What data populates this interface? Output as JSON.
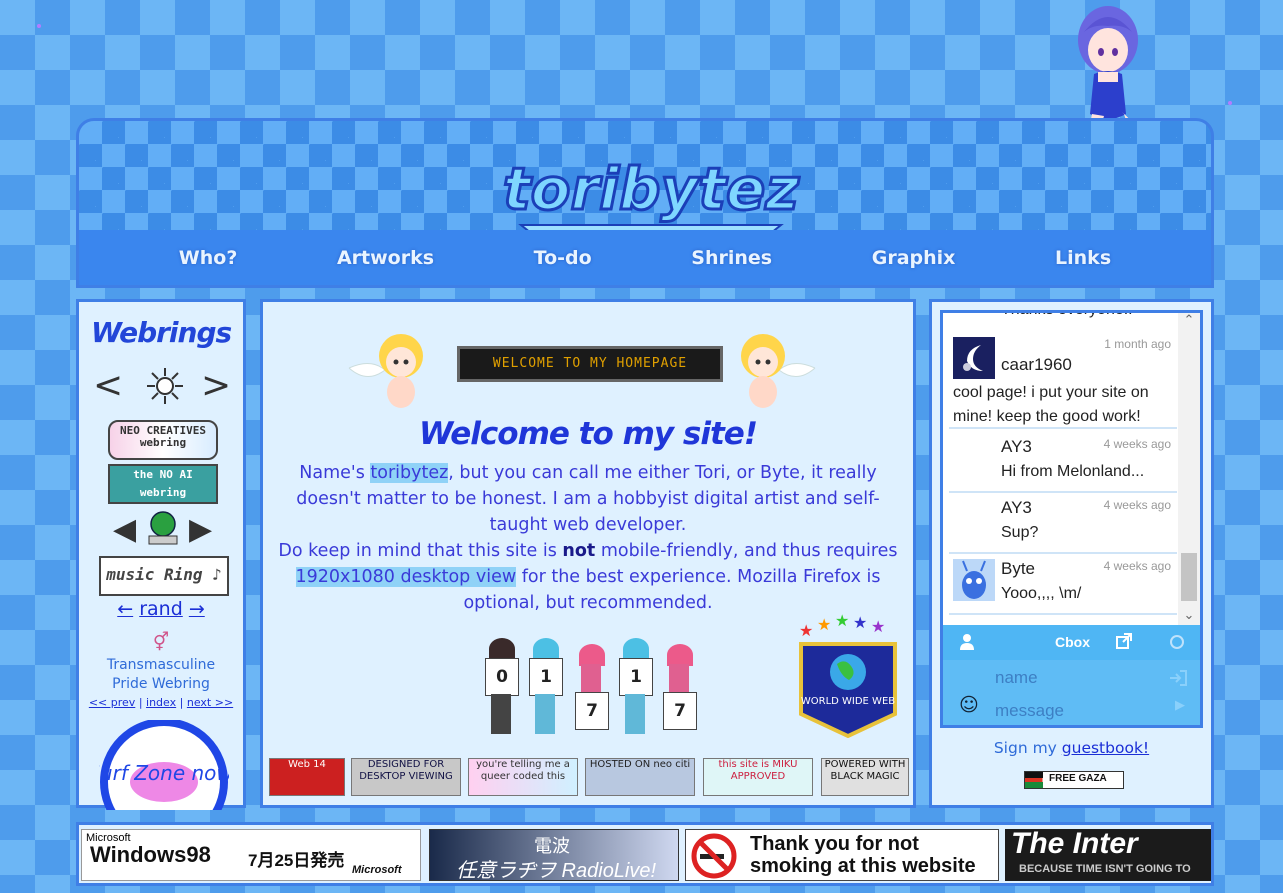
{
  "header": {
    "logo_text": "toribytez",
    "nav": [
      "Who?",
      "Artworks",
      "To-do",
      "Shrines",
      "Graphix",
      "Links"
    ]
  },
  "left": {
    "title": "Webrings",
    "prev_symbol": "<",
    "next_symbol": ">",
    "neo_badge": "NEO CREATIVES webring",
    "noai_badge_a": "the NO AI",
    "noai_badge_b": "webring",
    "music_badge": "music Ring",
    "rand_prev": "←",
    "rand_label": "rand",
    "rand_next": "→",
    "trans_title": "Transmasculine Pride Webring",
    "trans_prev": "<< prev",
    "trans_index": "index",
    "trans_next": "next >>",
    "sep": "|",
    "surf_text": "Surf Zone now!"
  },
  "main": {
    "marquee": "WELCOME TO MY HOMEPAGE",
    "title": "Welcome to my site!",
    "p1_a": "Name's ",
    "p1_name": "toribytez",
    "p1_b": ", but you can call me either Tori, or Byte, it really doesn't matter to be honest. I am a hobbyist digital artist and self-taught web developer.",
    "p2_a": "Do keep in mind that this site is ",
    "p2_not": "not",
    "p2_b": " mobile-friendly, and thus requires ",
    "p2_hl": "1920x1080 desktop view",
    "p2_c": " for the best experience. Mozilla Firefox is optional, but recommended.",
    "counter_digits": [
      "0",
      "1",
      "7",
      "1",
      "7"
    ],
    "www_badge": "WORLD WIDE WEB",
    "badges": [
      {
        "label": "Web 14",
        "color": "#cc2020"
      },
      {
        "label": "DESIGNED FOR DESKTOP VIEWING",
        "color": "#c8c8c8"
      },
      {
        "label": "you're telling me a queer coded this",
        "color": "#f0a0e0"
      },
      {
        "label": "HOSTED ON neo citi",
        "color": "#b8c8e0"
      },
      {
        "label": "this site is MIKU APPROVED",
        "color": "#7fd9e0"
      },
      {
        "label": "POWERED WITH BLACK MAGIC",
        "color": "#d0d0d0"
      }
    ]
  },
  "cbox": {
    "cutoff_text": "Thanks everyone!!",
    "messages": [
      {
        "name": "caar1960",
        "time": "1 month ago",
        "text": "cool page! i put your site on mine! keep the good work!"
      },
      {
        "name": "AY3",
        "time": "4 weeks ago",
        "text": "Hi from Melonland..."
      },
      {
        "name": "AY3",
        "time": "4 weeks ago",
        "text": "Sup?"
      },
      {
        "name": "Byte",
        "time": "4 weeks ago",
        "text": "Yooo,,,, \\m/"
      }
    ],
    "bar_label": "Cbox",
    "name_placeholder": "name",
    "message_placeholder": "message",
    "sign_text": "Sign my ",
    "guestbook": "guestbook!",
    "free_gaza": "FREE GAZA"
  },
  "bottom": {
    "windows_a": "Microsoft",
    "windows_b": "Windows98",
    "windows_c": "7月25日発売",
    "windows_d": "Microsoft",
    "radio": "任意ラヂヲ RadioLive!",
    "radio_top": "電波",
    "nosmoke_line1": "Thank you for not",
    "nosmoke_line2": "smoking at this website",
    "internet_line1": "The Inter",
    "internet_line2": "BECAUSE TIME ISN'T GOING TO"
  }
}
